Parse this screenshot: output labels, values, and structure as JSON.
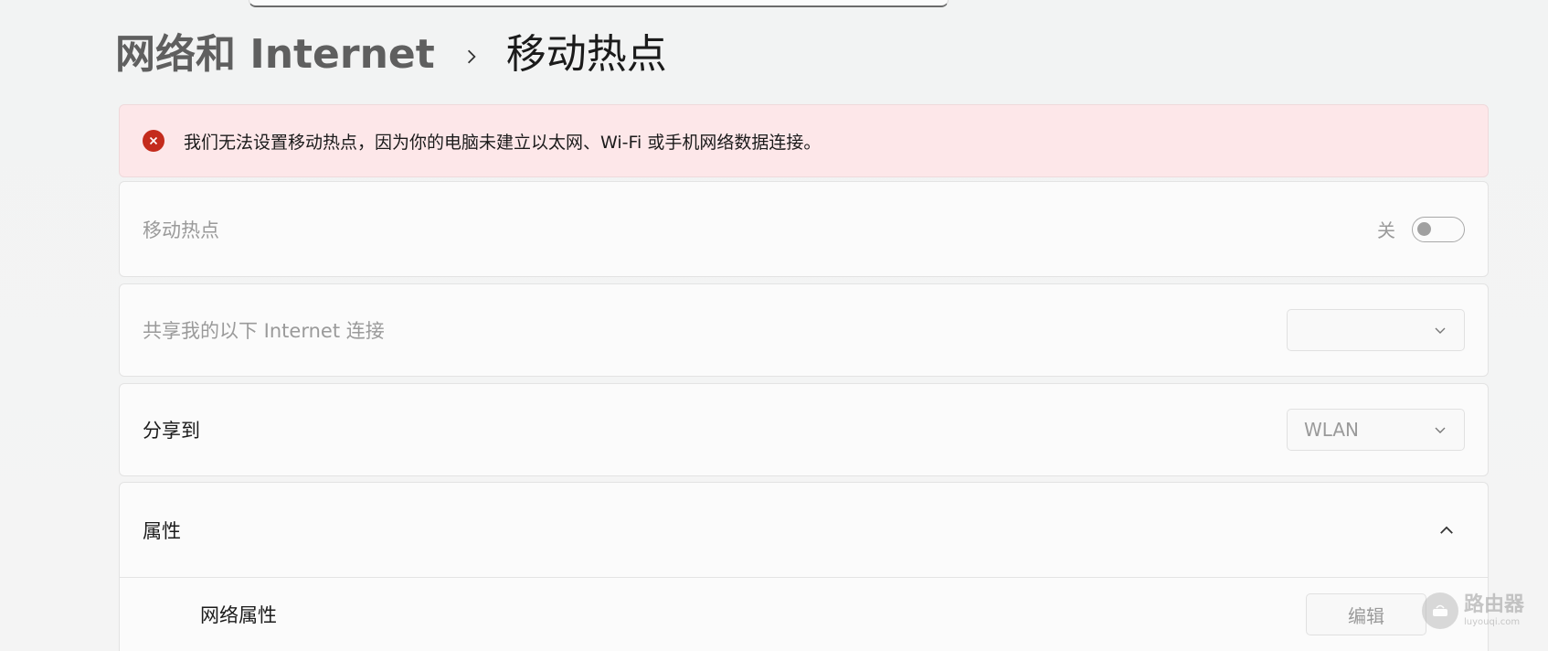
{
  "breadcrumb": {
    "parent": "网络和 Internet",
    "current": "移动热点"
  },
  "error_banner": {
    "icon": "error-circle-icon",
    "message": "我们无法设置移动热点，因为你的电脑未建立以太网、Wi-Fi 或手机网络数据连接。",
    "accent_color": "#c42b1c",
    "background_color": "#fde7e9"
  },
  "hotspot": {
    "label": "移动热点",
    "toggle_state_label": "关",
    "enabled": false
  },
  "share_from": {
    "label": "共享我的以下 Internet 连接",
    "selected": ""
  },
  "share_to": {
    "label": "分享到",
    "selected": "WLAN"
  },
  "properties": {
    "label": "属性",
    "expanded": true,
    "network_properties_label": "网络属性",
    "edit_label": "编辑"
  },
  "watermark": {
    "title": "路由器",
    "url": "luyouqi.com"
  }
}
